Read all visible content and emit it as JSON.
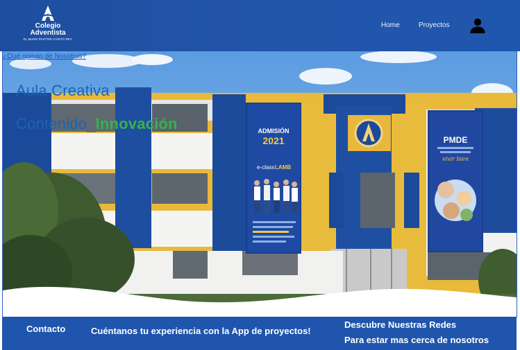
{
  "header": {
    "logo": {
      "name": "Colegio",
      "name2": "Adventista",
      "tagline": "EL BUEN PASTOR CANTO REY"
    },
    "nav": [
      {
        "label": "Home"
      },
      {
        "label": "Proyectos"
      }
    ],
    "user_icon": "user-icon"
  },
  "hero": {
    "review_link": "¿Qué opinan de Nosotros?",
    "headline1": "Aula Creativa",
    "headline2_part1": "Contenido",
    "headline2_highlight": "Innovación",
    "banner_left": {
      "title1": "ADMISIÓN",
      "title2": "2021",
      "logo1": "e-class",
      "logo2": "LAMB"
    },
    "banner_right": {
      "title": "PMDE",
      "script": "vivir bien"
    }
  },
  "footer": {
    "contact": "Contacto",
    "experience": "Cuéntanos tu experiencia con la App de proyectos!",
    "social_title": "Descubre Nuestras Redes",
    "social_sub": "Para estar mas cerca de nosotros"
  },
  "colors": {
    "navbar": "#1f56ad",
    "headline": "#1a64b4",
    "highlight": "#37b24d",
    "link": "#1a55c8"
  }
}
